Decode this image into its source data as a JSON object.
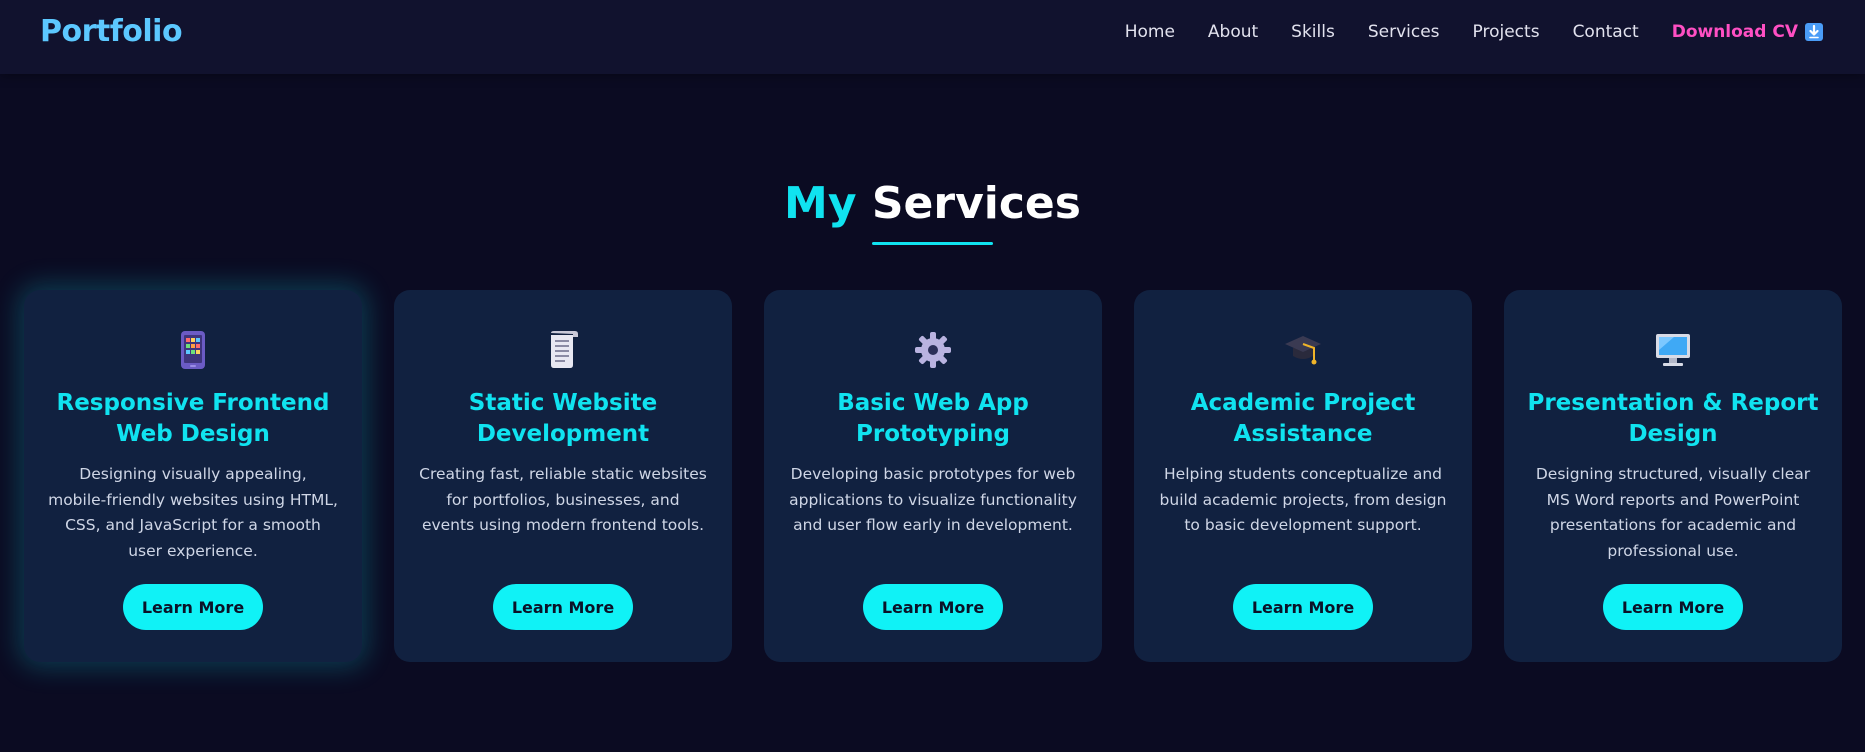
{
  "nav": {
    "logo": "Portfolio",
    "links": [
      "Home",
      "About",
      "Skills",
      "Services",
      "Projects",
      "Contact"
    ],
    "cv_label": "Download CV",
    "cv_icon": "download-icon"
  },
  "section": {
    "title_accent": "My",
    "title_rest": "Services"
  },
  "cards": [
    {
      "icon": "mobile-phone-icon",
      "title": "Responsive Frontend Web Design",
      "description": "Designing visually appealing, mobile-friendly websites using HTML, CSS, and JavaScript for a smooth user experience.",
      "button": "Learn More"
    },
    {
      "icon": "document-scroll-icon",
      "title": "Static Website Development",
      "description": "Creating fast, reliable static websites for portfolios, businesses, and events using modern frontend tools.",
      "button": "Learn More"
    },
    {
      "icon": "gear-icon",
      "title": "Basic Web App Prototyping",
      "description": "Developing basic prototypes for web applications to visualize functionality and user flow early in development.",
      "button": "Learn More"
    },
    {
      "icon": "graduation-cap-icon",
      "title": "Academic Project Assistance",
      "description": "Helping students conceptualize and build academic projects, from design to basic development support.",
      "button": "Learn More"
    },
    {
      "icon": "desktop-computer-icon",
      "title": "Presentation & Report Design",
      "description": "Designing structured, visually clear MS Word reports and PowerPoint presentations for academic and professional use.",
      "button": "Learn More"
    }
  ],
  "colors": {
    "background": "#0b0b22",
    "navbar": "#11122e",
    "card": "#112140",
    "accent": "#10e3f0",
    "logo": "#5cc8ff",
    "cv_link": "#ff4fc3"
  }
}
